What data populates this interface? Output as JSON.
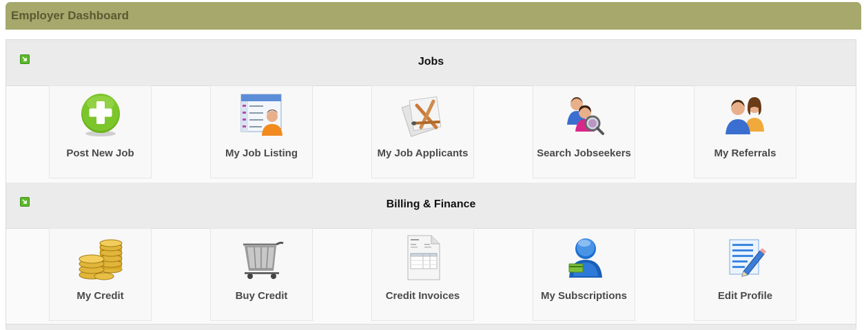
{
  "dashboard": {
    "title": "Employer Dashboard"
  },
  "sections": [
    {
      "title": "Jobs",
      "items": [
        {
          "label": "Post New Job",
          "icon": "plus-circle-icon"
        },
        {
          "label": "My Job Listing",
          "icon": "job-listing-icon"
        },
        {
          "label": "My Job Applicants",
          "icon": "applicants-icon"
        },
        {
          "label": "Search Jobseekers",
          "icon": "search-people-icon"
        },
        {
          "label": "My Referrals",
          "icon": "referrals-icon"
        }
      ]
    },
    {
      "title": "Billing & Finance",
      "items": [
        {
          "label": "My Credit",
          "icon": "coins-icon"
        },
        {
          "label": "Buy Credit",
          "icon": "cart-icon"
        },
        {
          "label": "Credit Invoices",
          "icon": "invoice-icon"
        },
        {
          "label": "My Subscriptions",
          "icon": "subscriptions-icon"
        },
        {
          "label": "Edit Profile",
          "icon": "edit-profile-icon"
        }
      ]
    }
  ],
  "colors": {
    "header_bar": "#a6a86c",
    "header_text": "#595a33",
    "toggle_green": "#5cb82c",
    "section_bg": "#ebebeb"
  }
}
